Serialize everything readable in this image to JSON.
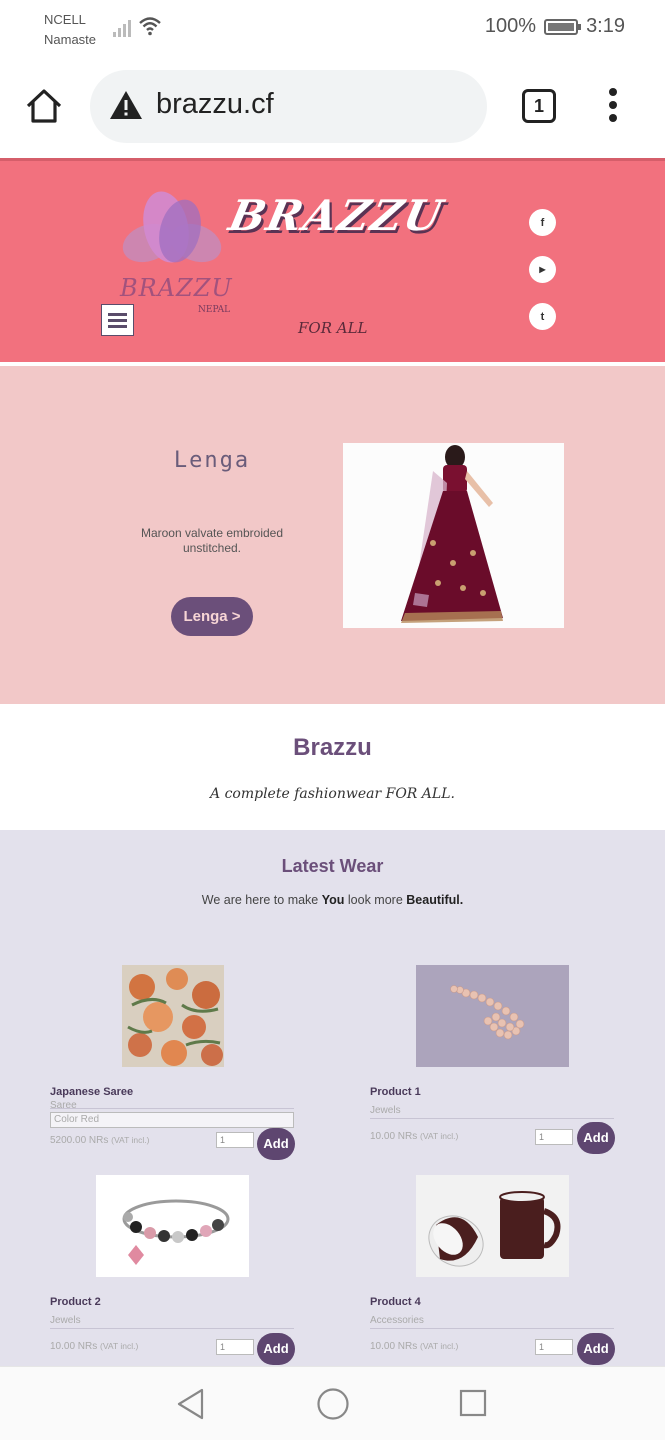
{
  "status_bar": {
    "carrier_line1": "NCELL",
    "carrier_line2": "Namaste",
    "battery": "100%",
    "time": "3:19"
  },
  "browser": {
    "url": "brazzu.cf",
    "tab_count": "1"
  },
  "header": {
    "brand": "BRAZZU",
    "logo_text": "BRAZZU",
    "logo_sub": "NEPAL",
    "tagline": "FOR ALL",
    "social": [
      {
        "icon": "facebook-icon",
        "glyph": "f"
      },
      {
        "icon": "youtube-icon",
        "glyph": "▶"
      },
      {
        "icon": "twitter-icon",
        "glyph": "t"
      }
    ]
  },
  "hero": {
    "title": "Lenga",
    "description": "Maroon valvate embroided unstitched.",
    "button": "Lenga >"
  },
  "about": {
    "title": "Brazzu",
    "tagline": "A complete fashionwear FOR ALL."
  },
  "latest": {
    "title": "Latest Wear",
    "sub_pre": "We are here to make ",
    "sub_b1": "You",
    "sub_mid": " look more ",
    "sub_b2": "Beautiful.",
    "products": [
      {
        "name": "Japanese Saree",
        "category": "Saree",
        "option": "Color Red",
        "price": "5200.00 NRs",
        "vat": "(VAT incl.)",
        "qty": "1",
        "add": "Add"
      },
      {
        "name": "Product 1",
        "category": "Jewels",
        "price": "10.00 NRs",
        "vat": "(VAT incl.)",
        "qty": "1",
        "add": "Add"
      },
      {
        "name": "Product 2",
        "category": "Jewels",
        "price": "10.00 NRs",
        "vat": "(VAT incl.)",
        "qty": "1",
        "add": "Add"
      },
      {
        "name": "Product 4",
        "category": "Accessories",
        "price": "10.00 NRs",
        "vat": "(VAT incl.)",
        "qty": "1",
        "add": "Add"
      }
    ]
  },
  "colors": {
    "header_bg": "#f2717e",
    "hero_bg": "#f2c8c8",
    "accent": "#6b4f7a",
    "latest_bg": "#e3e1ec"
  }
}
